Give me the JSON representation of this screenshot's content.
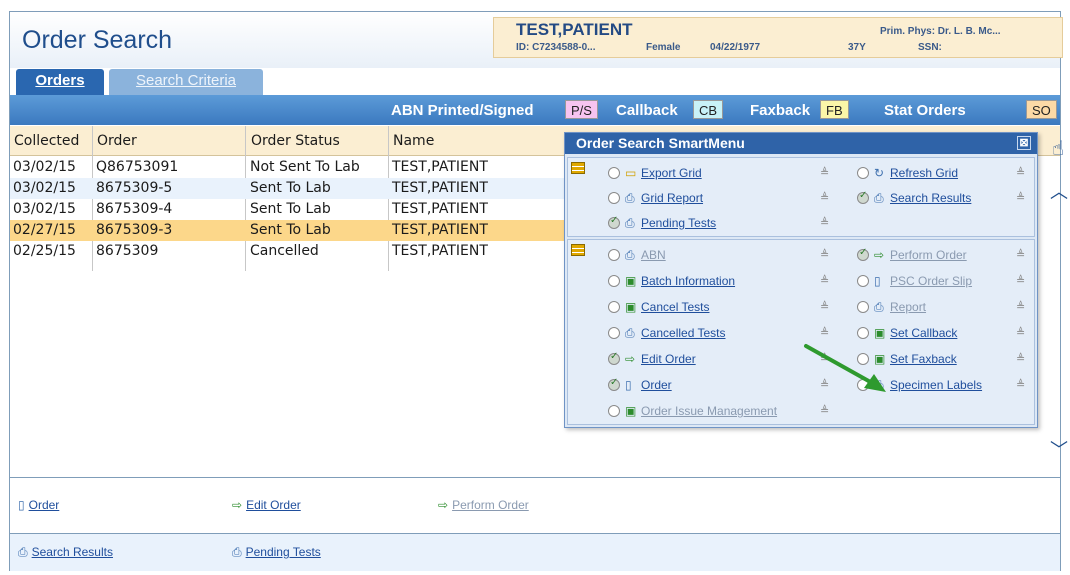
{
  "page": {
    "title": "Order Search"
  },
  "patient": {
    "name": "TEST,PATIENT",
    "id": "ID: C7234588-0...",
    "sex": "Female",
    "dob": "04/22/1977",
    "age": "37Y",
    "physician": "Prim. Phys: Dr. L. B. Mc...",
    "ssn": "SSN:"
  },
  "tabs": [
    {
      "label": "Orders",
      "active": true
    },
    {
      "label": "Search Criteria",
      "active": false
    }
  ],
  "legend": {
    "abn_label": "ABN Printed/Signed",
    "abn_code": "P/S",
    "callback_label": "Callback",
    "callback_code": "CB",
    "faxback_label": "Faxback",
    "faxback_code": "FB",
    "stat_label": "Stat Orders",
    "stat_code": "SO",
    "colors": {
      "ps": "#f7c4f0",
      "cb": "#c8f2f7",
      "fb": "#fbf6a8",
      "so": "#fcd9a6"
    }
  },
  "grid": {
    "columns": [
      "Collected",
      "Order",
      "Order Status",
      "Name"
    ],
    "rows": [
      {
        "collected": "03/02/15",
        "order": "Q86753091",
        "status": "Not Sent To Lab",
        "name": "TEST,PATIENT"
      },
      {
        "collected": "03/02/15",
        "order": "8675309-5",
        "status": "Sent To Lab",
        "name": "TEST,PATIENT"
      },
      {
        "collected": "03/02/15",
        "order": "8675309-4",
        "status": "Sent To Lab",
        "name": "TEST,PATIENT"
      },
      {
        "collected": "02/27/15",
        "order": "8675309-3",
        "status": "Sent To Lab",
        "name": "TEST,PATIENT"
      },
      {
        "collected": "02/25/15",
        "order": "8675309",
        "status": "Cancelled",
        "name": "TEST,PATIENT"
      }
    ]
  },
  "smart_menu": {
    "title": "Order Search SmartMenu",
    "close": "⊠",
    "section1": {
      "left": [
        {
          "label": "Export Grid",
          "icon": "folder-icon",
          "checked": false
        },
        {
          "label": "Grid Report",
          "icon": "printer-icon",
          "checked": false
        },
        {
          "label": "Pending Tests",
          "icon": "printer-icon",
          "checked": true
        }
      ],
      "right": [
        {
          "label": "Refresh Grid",
          "icon": "refresh-icon",
          "checked": false
        },
        {
          "label": "Search Results",
          "icon": "printer-icon",
          "checked": true
        }
      ]
    },
    "section2": {
      "left": [
        {
          "label": "ABN",
          "icon": "printer-icon",
          "checked": false,
          "dim": true
        },
        {
          "label": "Batch Information",
          "icon": "document-icon",
          "checked": false
        },
        {
          "label": "Cancel Tests",
          "icon": "document-icon",
          "checked": false
        },
        {
          "label": "Cancelled Tests",
          "icon": "printer-icon",
          "checked": false
        },
        {
          "label": "Edit Order",
          "icon": "arrow-icon",
          "checked": true
        },
        {
          "label": "Order",
          "icon": "page-icon",
          "checked": true
        },
        {
          "label": "Order Issue Management",
          "icon": "issue-icon",
          "checked": false,
          "dim": true
        }
      ],
      "right": [
        {
          "label": "Perform Order",
          "icon": "arrow-icon",
          "checked": true,
          "dim": true
        },
        {
          "label": "PSC Order Slip",
          "icon": "page-icon",
          "checked": false,
          "dim": true
        },
        {
          "label": "Report",
          "icon": "printer-icon",
          "checked": false,
          "dim": true
        },
        {
          "label": "Set Callback",
          "icon": "document-icon",
          "checked": false
        },
        {
          "label": "Set Faxback",
          "icon": "document-icon",
          "checked": false
        },
        {
          "label": "Specimen Labels",
          "icon": "printer-icon",
          "checked": false
        }
      ]
    }
  },
  "actions_row1": [
    {
      "label": "Order",
      "icon": "page-icon",
      "dim": false
    },
    {
      "label": "Edit Order",
      "icon": "arrow-icon",
      "dim": false
    },
    {
      "label": "Perform Order",
      "icon": "arrow-icon",
      "dim": true
    }
  ],
  "actions_row2": [
    {
      "label": "Search Results",
      "icon": "printer-icon"
    },
    {
      "label": "Pending Tests",
      "icon": "printer-icon"
    }
  ]
}
